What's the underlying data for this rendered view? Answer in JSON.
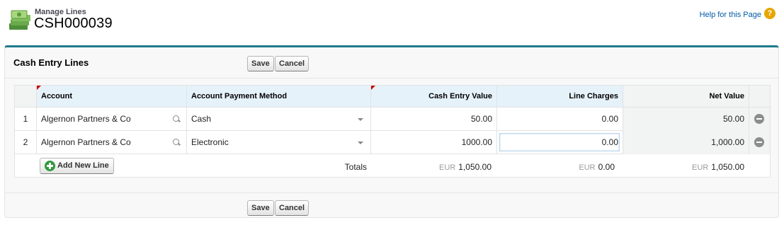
{
  "header": {
    "subtitle": "Manage Lines",
    "title": "CSH000039",
    "help_link": "Help for this Page",
    "help_icon": "?"
  },
  "panel": {
    "title": "Cash Entry Lines",
    "save_label": "Save",
    "cancel_label": "Cancel"
  },
  "table": {
    "columns": [
      "Account",
      "Account Payment Method",
      "Cash Entry Value",
      "Line Charges",
      "Net Value"
    ],
    "rows": [
      {
        "num": "1",
        "account": "Algernon Partners & Co",
        "method": "Cash",
        "cash_value": "50.00",
        "line_charges": "0.00",
        "net_value": "50.00"
      },
      {
        "num": "2",
        "account": "Algernon Partners & Co",
        "method": "Electronic",
        "cash_value": "1000.00",
        "line_charges": "0.00",
        "net_value": "1,000.00"
      }
    ],
    "add_line_label": "Add New Line",
    "totals_label": "Totals",
    "totals": {
      "cash_value": {
        "currency": "EUR",
        "amount": "1,050.00"
      },
      "line_charges": {
        "currency": "EUR",
        "amount": "0.00"
      },
      "net_value": {
        "currency": "EUR",
        "amount": "1,050.00"
      }
    }
  },
  "colors": {
    "accent_border": "#1e7a8c",
    "link": "#015ba7",
    "required_marker": "#cc0000"
  }
}
